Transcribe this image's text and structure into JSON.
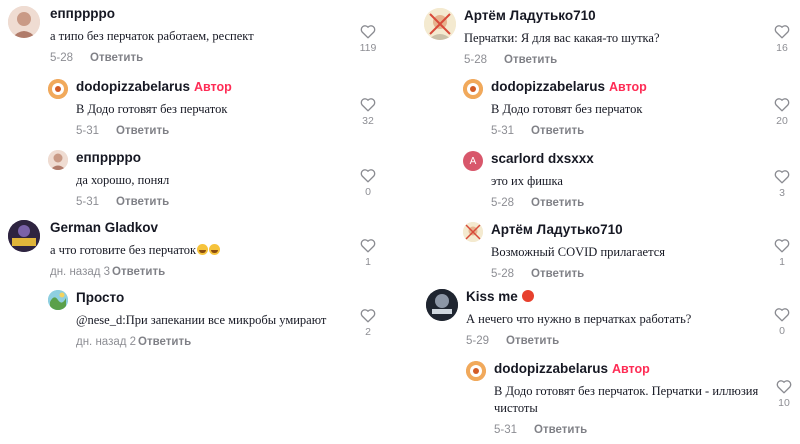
{
  "ui": {
    "author_badge": "Автор",
    "reply_label": "Ответить",
    "heart_icon": "heart-icon-outline",
    "colors": {
      "author": "#fe2c55",
      "text": "#161823",
      "muted": "#8a8b91"
    }
  },
  "left": [
    {
      "user": "еппрррро",
      "author": false,
      "text": "а типо без перчаток работаем, респект",
      "date": "5-28",
      "likes": "119"
    },
    {
      "user": "dodopizzabelarus",
      "author": true,
      "text": "В Додо готовят без перчаток",
      "date": "5-31",
      "likes": "32"
    },
    {
      "user": "еппрррро",
      "author": false,
      "text": "да хорошо, понял",
      "date": "5-31",
      "likes": "0"
    },
    {
      "user": "German Gladkov",
      "author": false,
      "text": "а что готовите без перчаток",
      "date": "дн. назад 3",
      "likes": "1"
    },
    {
      "user": "Просто",
      "author": false,
      "text": "@nese_d:При запекании все микробы умирают",
      "date": "дн. назад 2",
      "likes": "2"
    }
  ],
  "right": [
    {
      "user": "Артём Ладутько710",
      "author": false,
      "text": "Перчатки: Я для вас какая-то шутка?",
      "date": "5-28",
      "likes": "16"
    },
    {
      "user": "dodopizzabelarus",
      "author": true,
      "text": "В Додо готовят без перчаток",
      "date": "5-31",
      "likes": "20"
    },
    {
      "user": "scarlord dxsxxx",
      "author": false,
      "text": "это их фишка",
      "date": "5-28",
      "likes": "3",
      "avatar_letter": "A"
    },
    {
      "user": "Артём Ладутько710",
      "author": false,
      "text": "Возможный COVID прилагается",
      "date": "5-28",
      "likes": "1"
    },
    {
      "user": "Kiss me",
      "author": false,
      "text": "А нечего что нужно в перчатках работать?",
      "date": "5-29",
      "likes": "0"
    },
    {
      "user": "dodopizzabelarus",
      "author": true,
      "text": "В Додо готовят без перчаток. Перчатки - иллюзия чистоты",
      "date": "5-31",
      "likes": "10"
    }
  ]
}
